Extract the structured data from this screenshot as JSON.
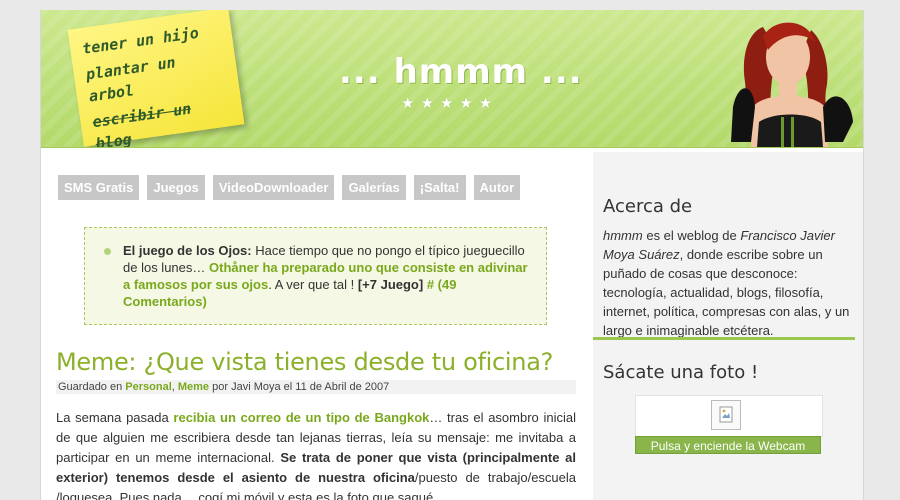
{
  "header": {
    "sticky_note": [
      "tener un hijo",
      "plantar un arbol",
      "escribir un blog"
    ],
    "site_title": "... hmmm ...",
    "stars": "★★★★★"
  },
  "nav": [
    "SMS Gratis",
    "Juegos",
    "VideoDownloader",
    "Galerías",
    "¡Salta!",
    "Autor"
  ],
  "notice": {
    "label": "El juego de los Ojos:",
    "text1": "Hace tiempo que no pongo el típico jueguecillo de los lunes…",
    "link1": "Othåner ha preparado uno que consiste en adivinar a famosos por sus ojos",
    "text2": ". A ver que tal !",
    "tag": "[+7 Juego]",
    "comments": "# (49 Comentarios)"
  },
  "post": {
    "title": "Meme: ¿Que vista tienes desde tu oficina?",
    "meta_prefix": "Guardado en",
    "cat1": "Personal",
    "cat2": "Meme",
    "meta_suffix": "por Javi Moya el 11 de Abril de 2007",
    "p1": "La semana pasada",
    "p1_link": "recibia un correo de un tipo de Bangkok",
    "p2": "… tras el asombro inicial de que alguien me escribiera desde tan lejanas tierras, leía su mensaje: me invitaba a participar en un meme internacional.",
    "p3_bold": "Se trata de poner que vista (principalmente al exterior) tenemos desde el asiento de nuestra oficina",
    "p4": "/puesto de trabajo/escuela /loquesea. Pues nada… cogí mi móvil y esta es la foto que saqué."
  },
  "sidebar": {
    "about_title": "Acerca de",
    "about_site": "hmmm",
    "about_text1": "es el weblog de",
    "about_author": "Francisco Javier Moya Suárez",
    "about_text2": ", donde escribe sobre un puñado de cosas que desconoce: tecnología, actualidad, blogs, filosofía, internet, política, compresas con alas, y un largo e inimaginable etcétera.",
    "photo_title": "Sácate una foto !",
    "webcam_button": "Pulsa y enciende la Webcam"
  }
}
